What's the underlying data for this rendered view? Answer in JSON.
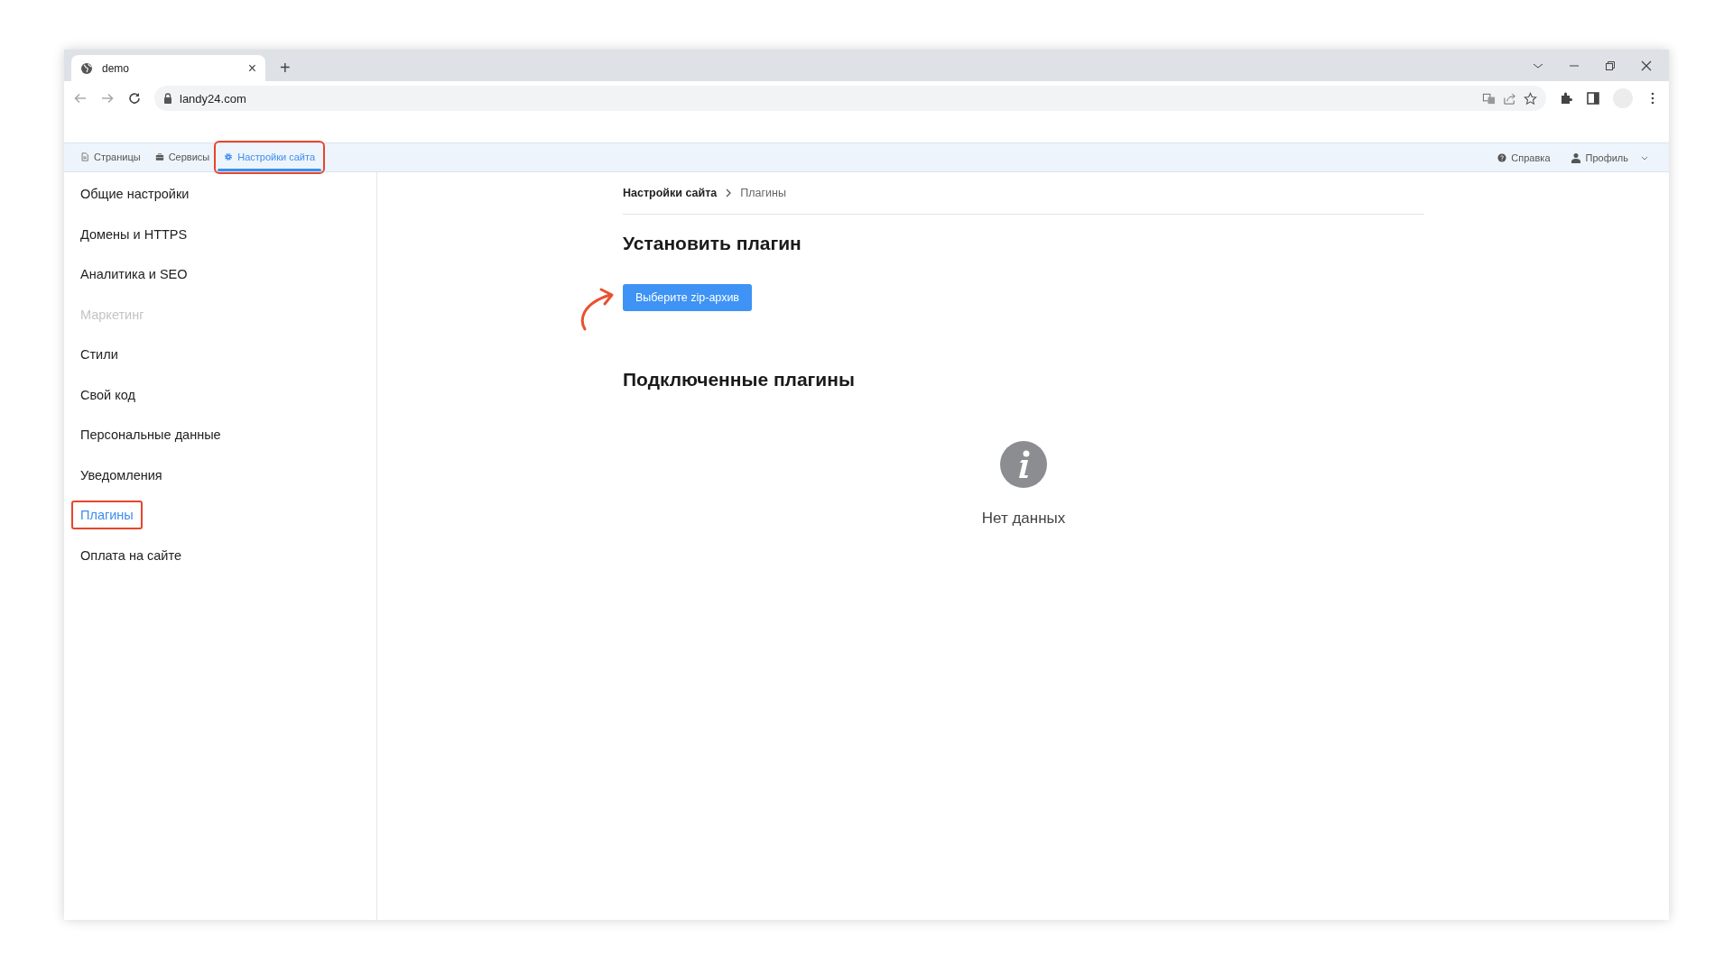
{
  "browser": {
    "tab_title": "demo",
    "tab_close": "×",
    "new_tab": "+",
    "url": "landy24.com"
  },
  "app_nav": {
    "tabs": [
      {
        "label": "Страницы",
        "selected": false,
        "annotated": false
      },
      {
        "label": "Сервисы",
        "selected": false,
        "annotated": false
      },
      {
        "label": "Настройки сайта",
        "selected": true,
        "annotated": true
      }
    ],
    "help": "Справка",
    "profile": "Профиль"
  },
  "sidebar": {
    "items": [
      {
        "label": "Общие настройки",
        "selected": false,
        "disabled": false,
        "annotated": false
      },
      {
        "label": "Домены и HTTPS",
        "selected": false,
        "disabled": false,
        "annotated": false
      },
      {
        "label": "Аналитика и SEO",
        "selected": false,
        "disabled": false,
        "annotated": false
      },
      {
        "label": "Маркетинг",
        "selected": false,
        "disabled": true,
        "annotated": false
      },
      {
        "label": "Стили",
        "selected": false,
        "disabled": false,
        "annotated": false
      },
      {
        "label": "Свой код",
        "selected": false,
        "disabled": false,
        "annotated": false
      },
      {
        "label": "Персональные данные",
        "selected": false,
        "disabled": false,
        "annotated": false
      },
      {
        "label": "Уведомления",
        "selected": false,
        "disabled": false,
        "annotated": false
      },
      {
        "label": "Плагины",
        "selected": true,
        "disabled": false,
        "annotated": true
      },
      {
        "label": "Оплата на сайте",
        "selected": false,
        "disabled": false,
        "annotated": false
      }
    ]
  },
  "breadcrumb": [
    "Настройки сайта",
    "Плагины"
  ],
  "install": {
    "title": "Установить плагин",
    "button": "Выберите zip-архив"
  },
  "installed": {
    "title": "Подключенные плагины",
    "empty": "Нет данных"
  }
}
